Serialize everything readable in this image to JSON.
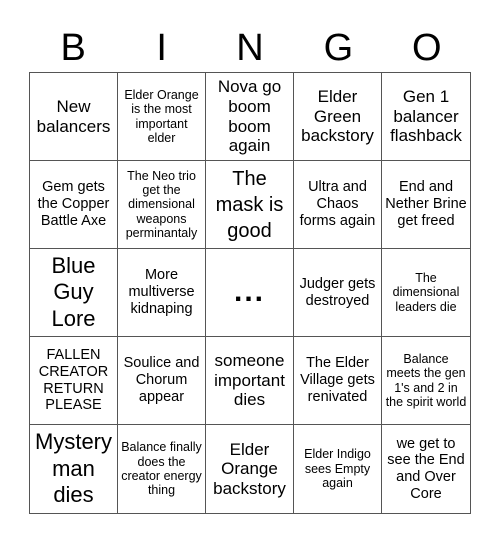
{
  "header": {
    "letters": [
      "B",
      "I",
      "N",
      "G",
      "O"
    ]
  },
  "card": {
    "cells": [
      "New balancers",
      "Elder Orange is the most important elder",
      "Nova go boom boom again",
      "Elder Green backstory",
      "Gen 1 balancer flashback",
      "Gem gets the Copper Battle Axe",
      "The Neo trio get the dimensional weapons perminantaly",
      "The mask is good",
      "Ultra and Chaos forms again",
      "End and Nether Brine get freed",
      "Blue Guy Lore",
      "More multiverse kidnaping",
      "...",
      "Judger gets destroyed",
      "The dimensional leaders die",
      "FALLEN CREATOR RETURN PLEASE",
      "Soulice and Chorum appear",
      "someone important dies",
      "The Elder Village gets renivated",
      "Balance meets the gen 1's and 2 in the spirit world",
      "Mystery man dies",
      "Balance finally does the creator energy thing",
      "Elder Orange backstory",
      "Elder Indigo sees Empty again",
      "we get to see the End and Over Core"
    ]
  }
}
